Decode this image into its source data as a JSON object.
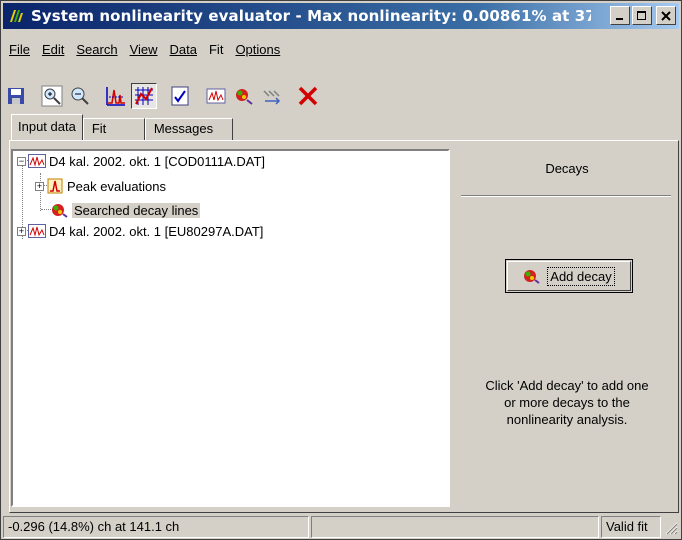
{
  "window": {
    "title": "System nonlinearity evaluator - Max nonlinearity: 0.00861% at 37..."
  },
  "menu": [
    "File",
    "Edit",
    "Search",
    "View",
    "Data",
    "Fit",
    "Options"
  ],
  "toolbar": {
    "buttons": [
      "save-icon",
      "zoom-in-icon",
      "zoom-out-icon",
      "peak-chart-icon",
      "grid-chart-icon",
      "report-icon",
      "spectrum-icon",
      "decay-icon",
      "fit-icon",
      "delete-icon"
    ]
  },
  "tabs": [
    "Input data",
    "Fit",
    "Messages"
  ],
  "tree": {
    "nodes": [
      {
        "label": "D4 kal. 2002. okt. 1 [COD0111A.DAT]",
        "expanded": true
      },
      {
        "label": "Peak evaluations",
        "expanded": false
      },
      {
        "label": "Searched decay lines",
        "selected": true
      },
      {
        "label": "D4 kal. 2002. okt. 1 [EU80297A.DAT]",
        "expanded": false
      }
    ]
  },
  "right_pane": {
    "title": "Decays",
    "add_button": "Add decay",
    "help_line1": "Click 'Add decay' to add one",
    "help_line2": "or more decays to the",
    "help_line3": "nonlinearity analysis."
  },
  "status": {
    "cursor": "-0.296 (14.8%) ch at 141.1 ch",
    "middle": "",
    "fit": "Valid fit"
  },
  "colors": {
    "title_start": "#0a246a",
    "title_end": "#a6caf0",
    "face": "#d4d0c8",
    "delete_red": "#d40000"
  }
}
